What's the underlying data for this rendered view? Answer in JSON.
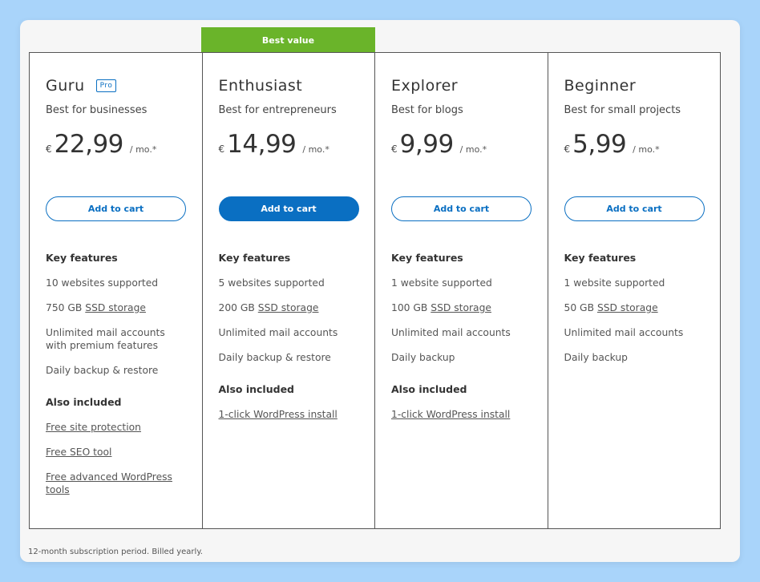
{
  "badge": "Best value",
  "plans": [
    {
      "name": "Guru",
      "tag": "Pro",
      "tagline": "Best for businesses",
      "currency": "€",
      "price": "22,99",
      "period": "/ mo.*",
      "cta": "Add to cart",
      "key_features_title": "Key features",
      "features": {
        "websites": "10 websites supported",
        "storage_prefix": "750 GB ",
        "storage_link": "SSD storage",
        "mail": "Unlimited mail accounts with premium features",
        "backup": "Daily backup & restore"
      },
      "also_title": "Also included",
      "also": [
        "Free site protection",
        "Free SEO tool",
        "Free advanced WordPress tools"
      ]
    },
    {
      "name": "Enthusiast",
      "tagline": "Best for entrepreneurs",
      "currency": "€",
      "price": "14,99",
      "period": "/ mo.*",
      "cta": "Add to cart",
      "key_features_title": "Key features",
      "features": {
        "websites": "5 websites supported",
        "storage_prefix": "200 GB ",
        "storage_link": "SSD storage",
        "mail": "Unlimited mail accounts",
        "backup": "Daily backup & restore"
      },
      "also_title": "Also included",
      "also": [
        "1-click WordPress install"
      ]
    },
    {
      "name": "Explorer",
      "tagline": "Best for blogs",
      "currency": "€",
      "price": "9,99",
      "period": "/ mo.*",
      "cta": "Add to cart",
      "key_features_title": "Key features",
      "features": {
        "websites": "1 website supported",
        "storage_prefix": "100 GB ",
        "storage_link": "SSD storage",
        "mail": "Unlimited mail accounts",
        "backup": "Daily backup"
      },
      "also_title": "Also included",
      "also": [
        "1-click WordPress install"
      ]
    },
    {
      "name": "Beginner",
      "tagline": "Best for small projects",
      "currency": "€",
      "price": "5,99",
      "period": "/ mo.*",
      "cta": "Add to cart",
      "key_features_title": "Key features",
      "features": {
        "websites": "1 website supported",
        "storage_prefix": "50 GB ",
        "storage_link": "SSD storage",
        "mail": "Unlimited mail accounts",
        "backup": "Daily backup"
      }
    }
  ],
  "footnote": "12-month subscription period. Billed yearly.",
  "colors": {
    "accent": "#0a6fc2",
    "badge": "#6ab42a",
    "background": "#a9d4fa"
  }
}
